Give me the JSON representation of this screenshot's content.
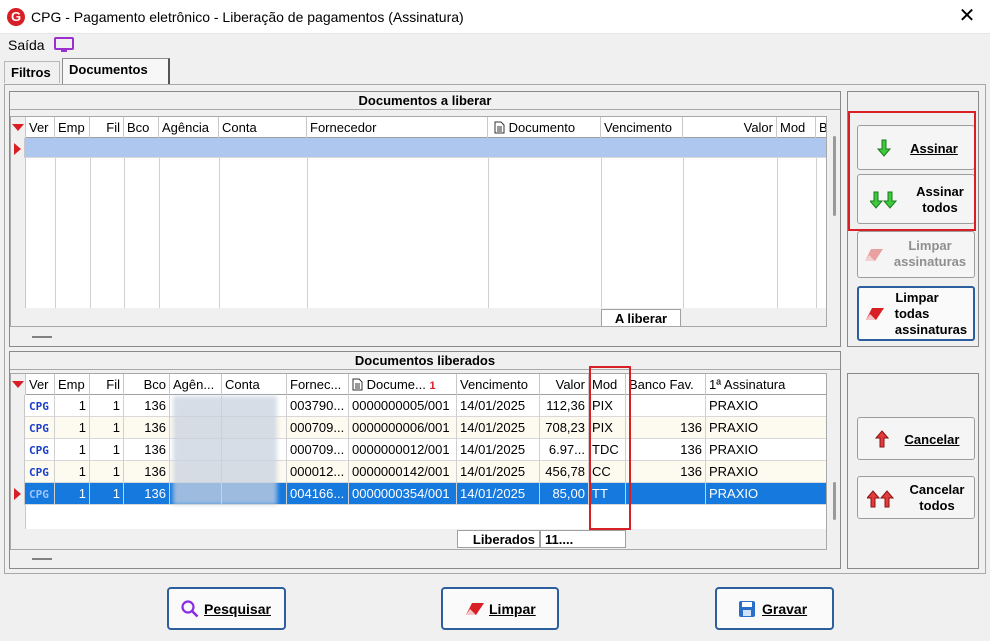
{
  "window": {
    "title": "CPG - Pagamento eletrônico - Liberação de pagamentos (Assinatura)",
    "close_glyph": "✕",
    "app_icon": "G"
  },
  "menu": {
    "saida": "Saída",
    "monitor_icon": "monitor-icon"
  },
  "tabs": [
    {
      "label": "Filtros"
    },
    {
      "label": "Documentos"
    }
  ],
  "top_panel": {
    "title": "Documentos a liberar",
    "columns": [
      "Ver",
      "Emp",
      "Fil",
      "Bco",
      "Agência",
      "Conta",
      "Fornecedor",
      "Documento",
      "Vencimento",
      "Valor",
      "Mod",
      "Ba"
    ],
    "footer_label": "A liberar"
  },
  "bottom_panel": {
    "title": "Documentos liberados",
    "columns": [
      "Ver",
      "Emp",
      "Fil",
      "Bco",
      "Agên...",
      "Conta",
      "Fornec...",
      "Docume...",
      "Vencimento",
      "Valor",
      "Mod",
      "Banco Fav.",
      "1ª Assinatura"
    ],
    "sort_indicator": "1",
    "rows": [
      {
        "ver": "CPG",
        "emp": "1",
        "fil": "1",
        "bco": "136",
        "fornec": "003790...",
        "doc": "0000000005/001",
        "venc": "14/01/2025",
        "valor": "112,36",
        "mod": "PIX",
        "banco_fav": "",
        "assin": "PRAXIO"
      },
      {
        "ver": "CPG",
        "emp": "1",
        "fil": "1",
        "bco": "136",
        "fornec": "000709...",
        "doc": "0000000006/001",
        "venc": "14/01/2025",
        "valor": "708,23",
        "mod": "PIX",
        "banco_fav": "136",
        "assin": "PRAXIO"
      },
      {
        "ver": "CPG",
        "emp": "1",
        "fil": "1",
        "bco": "136",
        "fornec": "000709...",
        "doc": "0000000012/001",
        "venc": "14/01/2025",
        "valor": "6.97...",
        "mod": "TDC",
        "banco_fav": "136",
        "assin": "PRAXIO"
      },
      {
        "ver": "CPG",
        "emp": "1",
        "fil": "1",
        "bco": "136",
        "fornec": "000012...",
        "doc": "0000000142/001",
        "venc": "14/01/2025",
        "valor": "456,78",
        "mod": "CC",
        "banco_fav": "136",
        "assin": "PRAXIO"
      },
      {
        "ver": "CPG",
        "emp": "1",
        "fil": "1",
        "bco": "136",
        "fornec": "004166...",
        "doc": "0000000354/001",
        "venc": "14/01/2025",
        "valor": "85,00",
        "mod": "TT",
        "banco_fav": "",
        "assin": "PRAXIO"
      }
    ],
    "footer_label": "Liberados",
    "footer_value": "11...."
  },
  "side_buttons": {
    "assinar": "Assinar",
    "assinar_todos": [
      "Assinar",
      "todos"
    ],
    "limpar_assinaturas": [
      "Limpar",
      "assinaturas"
    ],
    "limpar_todas": [
      "Limpar",
      "todas",
      "assinaturas"
    ],
    "cancelar": "Cancelar",
    "cancelar_todos": [
      "Cancelar",
      "todos"
    ]
  },
  "bottom_buttons": {
    "pesquisar": "Pesquisar",
    "limpar": "Limpar",
    "gravar": "Gravar"
  },
  "colors": {
    "accent_red": "#d81f26",
    "selection": "#1679de",
    "header_row_highlight": "#aec7ee",
    "border_blue": "#2d5f9e"
  }
}
